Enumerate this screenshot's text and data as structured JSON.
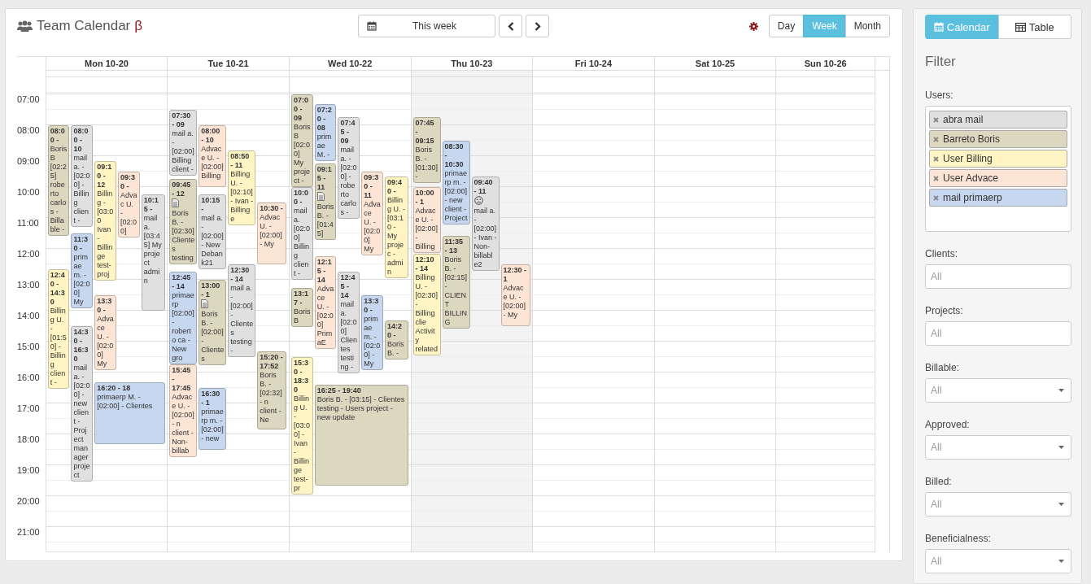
{
  "header": {
    "title": "Team Calendar",
    "badge": "β",
    "range_button": "This week",
    "views": [
      {
        "label": "Day",
        "selected": false
      },
      {
        "label": "Week",
        "selected": true
      },
      {
        "label": "Month",
        "selected": false
      }
    ]
  },
  "calendar": {
    "hours": [
      "07:00",
      "08:00",
      "09:00",
      "10:00",
      "11:00",
      "12:00",
      "13:00",
      "14:00",
      "15:00",
      "16:00",
      "17:00",
      "18:00",
      "19:00",
      "20:00",
      "21:00"
    ],
    "days": [
      {
        "label": "Mon 10-20",
        "today": false,
        "events": [
          {
            "time": "08:00 -",
            "text": "Boris B [02:25] roberto carlos - Billable -",
            "color": "#dcd7bf",
            "kind": "plain"
          },
          {
            "time": "08:00 - 10",
            "text": "mail a. - [02:00] - Billing client -",
            "color": "#e0e0e0",
            "kind": "plain"
          },
          {
            "time": "09:10 - 12",
            "text": "Billing - [03:00 Ivan - Billinge test-proj",
            "color": "#fff5c4",
            "kind": "plain"
          },
          {
            "time": "09:30 -",
            "text": "Advac U. - [02:00]",
            "color": "#fde5d6",
            "kind": "plain"
          },
          {
            "time": "10:15 -",
            "text": "mail a. [03:45] My project admin",
            "color": "#e0e0e0",
            "kind": "plain"
          },
          {
            "time": "11:30 -",
            "text": "primae m. - [02:00] My",
            "color": "#c6d7ef",
            "kind": "plain"
          },
          {
            "time": "12:40 - 14:30",
            "text": "Billing U. - [01:50] - Billing client -",
            "color": "#fff5c4",
            "kind": "plain"
          },
          {
            "time": "13:30 -",
            "text": "Advace U. - [02:00] My",
            "color": "#fde5d6",
            "kind": "plain"
          },
          {
            "time": "14:30 - 16:30",
            "text": "mail a. - [02:00] - new client - Project manager project",
            "color": "#e0e0e0",
            "kind": "plain"
          },
          {
            "time": "16:20 - 18",
            "text": "primaerp M. - [02:00] - Clientes",
            "color": "#c6d7ef",
            "kind": "plain"
          }
        ]
      },
      {
        "label": "Tue 10-21",
        "today": false,
        "events": [
          {
            "time": "07:30 - 09",
            "text": "mail a. - [02:00] Billing client -",
            "color": "#e0e0e0",
            "kind": "plain"
          },
          {
            "time": "08:00 - 10",
            "text": "Advace U. - [02:00] Billing",
            "color": "#fde5d6",
            "kind": "plain"
          },
          {
            "time": "08:50 - 11",
            "text": "Billing U. - [02:10] - Ivan - Billinge",
            "color": "#fff5c4",
            "kind": "plain"
          },
          {
            "time": "09:45 - 12",
            "text": "Boris B. - [02:30] Clientes testing",
            "color": "#dcd7bf",
            "kind": "note"
          },
          {
            "time": "10:15 -",
            "text": "mail a. - [02:00] - New Debank21",
            "color": "#e0e0e0",
            "kind": "plain"
          },
          {
            "time": "10:30 -",
            "text": "Advac U. - [02:00] - My",
            "color": "#fde5d6",
            "kind": "plain"
          },
          {
            "time": "12:30 - 14",
            "text": "mail a. - [02:00] - Clientes testing -",
            "color": "#e0e0e0",
            "kind": "plain"
          },
          {
            "time": "12:45 - 14",
            "text": "primaerp [02:00] - roberto ca - New gro",
            "color": "#c6d7ef",
            "kind": "plain"
          },
          {
            "time": "13:00 - 1",
            "text": "Boris B. - [02:00] - Clientes",
            "color": "#dcd7bf",
            "kind": "note"
          },
          {
            "time": "15:20 - 17:52",
            "text": "Boris B. - [02:32] - n client - Ne",
            "color": "#dcd7bf",
            "kind": "plain"
          },
          {
            "time": "15:45 - 17:45",
            "text": "Advace U. - [02:00] - n client - Non-billab",
            "color": "#fde5d6",
            "kind": "plain"
          },
          {
            "time": "16:30 - 1",
            "text": "primaerp m. - [02:00] - new",
            "color": "#c6d7ef",
            "kind": "plain"
          }
        ]
      },
      {
        "label": "Wed 10-22",
        "today": false,
        "events": [
          {
            "time": "07:00 - 09",
            "text": "Boris B [02:00] My project -",
            "color": "#dcd7bf",
            "kind": "plain"
          },
          {
            "time": "07:20 - 08",
            "text": "primae M. -",
            "color": "#c6d7ef",
            "kind": "plain"
          },
          {
            "time": "07:45 - 09",
            "text": "mail a. - [02:00] - roberto carlos -",
            "color": "#e0e0e0",
            "kind": "plain"
          },
          {
            "time": "09:15 - 11",
            "text": "Boris B. - [01:45]",
            "color": "#dcd7bf",
            "kind": "note"
          },
          {
            "time": "09:30 - 11",
            "text": "Advace U. - [02:00] My",
            "color": "#fde5d6",
            "kind": "plain"
          },
          {
            "time": "10:00 -",
            "text": "mail a. [02:00] Billing client -",
            "color": "#e0e0e0",
            "kind": "plain"
          },
          {
            "time": "09:40 -",
            "text": "Billing U. - [03:10 - My projec - admin",
            "color": "#fff5c4",
            "kind": "plain"
          },
          {
            "time": "12:15 - 14",
            "text": "Advace U. - [02:00] PrimaE",
            "color": "#fde5d6",
            "kind": "plain"
          },
          {
            "time": "12:45 - 14",
            "text": "mail a. [02:00] Clientes testing -",
            "color": "#e0e0e0",
            "kind": "plain"
          },
          {
            "time": "13:17 -",
            "text": "Boris B",
            "color": "#dcd7bf",
            "kind": "plain"
          },
          {
            "time": "13:30 -",
            "text": "primae m. - [02:00] - My",
            "color": "#c6d7ef",
            "kind": "plain"
          },
          {
            "time": "14:20 -",
            "text": "Boris B. -",
            "color": "#dcd7bf",
            "kind": "plain"
          },
          {
            "time": "15:30 - 18:30",
            "text": "Billing U. - [03:00] - Ivan - Billinge test-pr",
            "color": "#fff5c4",
            "kind": "plain"
          },
          {
            "time": "16:25 - 19:40",
            "text": "Boris B. - [03:15] - Clientes testing - Users project - new update",
            "color": "#dcd7bf",
            "kind": "plain"
          }
        ]
      },
      {
        "label": "Thu 10-23",
        "today": true,
        "events": [
          {
            "time": "07:45 - 09:15",
            "text": "Boris B. - [01:30] -",
            "color": "#dcd7bf",
            "kind": "plain"
          },
          {
            "time": "08:30 - 10:30",
            "text": "primaerp m. - [02:00] - new client - Project",
            "color": "#c6d7ef",
            "kind": "plain"
          },
          {
            "time": "10:00 - 1",
            "text": "Advace U. - [02:00] - Billing",
            "color": "#fde5d6",
            "kind": "plain"
          },
          {
            "time": "09:40 - 11",
            "text": "mail a. - [02:00] - Ivan - Non-billable2",
            "color": "#e0e0e0",
            "kind": "alert"
          },
          {
            "time": "11:35 - 13",
            "text": "Boris B. - [02:15] - CLIENT BILLING",
            "color": "#dcd7bf",
            "kind": "plain"
          },
          {
            "time": "12:10 - 14",
            "text": "Billing U. - [02:30] - Billing clie Activity related",
            "color": "#fff5c4",
            "kind": "plain"
          },
          {
            "time": "12:30 - 1",
            "text": "Advace U. - [02:00] - My",
            "color": "#fde5d6",
            "kind": "plain"
          }
        ]
      },
      {
        "label": "Fri 10-24",
        "today": false
      },
      {
        "label": "Sat 10-25",
        "today": false
      },
      {
        "label": "Sun 10-26",
        "today": false
      }
    ]
  },
  "sidebar": {
    "tabs": [
      {
        "label": "Calendar",
        "selected": true
      },
      {
        "label": "Table",
        "selected": false
      }
    ],
    "heading": "Filter",
    "users": {
      "label": "Users:",
      "chips": [
        {
          "label": "abra mail",
          "color": "#e0e0e0"
        },
        {
          "label": "Barreto Boris",
          "color": "#dcd7bf"
        },
        {
          "label": "User Billing",
          "color": "#fff5c4"
        },
        {
          "label": "User Advace",
          "color": "#fde5d6"
        },
        {
          "label": "mail primaerp",
          "color": "#c6d7ef"
        }
      ]
    },
    "filters": [
      {
        "label": "Clients:",
        "kind": "input",
        "placeholder": "All"
      },
      {
        "label": "Projects:",
        "kind": "input",
        "placeholder": "All"
      },
      {
        "label": "Billable:",
        "kind": "select",
        "placeholder": "All"
      },
      {
        "label": "Approved:",
        "kind": "select",
        "placeholder": "All"
      },
      {
        "label": "Billed:",
        "kind": "select",
        "placeholder": "All"
      },
      {
        "label": "Beneficialness:",
        "kind": "select",
        "placeholder": "All"
      }
    ]
  }
}
